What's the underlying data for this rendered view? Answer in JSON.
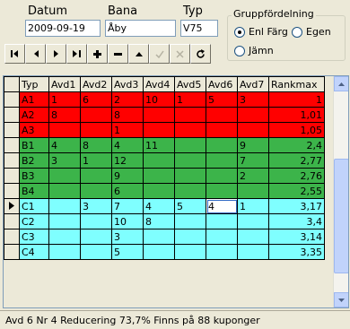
{
  "form": {
    "datum_label": "Datum",
    "datum_value": "2009-09-19",
    "bana_label": "Bana",
    "bana_value": "Åby",
    "typ_label": "Typ",
    "typ_value": "V75"
  },
  "group": {
    "title": "Gruppfördelning",
    "options": [
      {
        "label": "Enl Färg",
        "selected": true
      },
      {
        "label": "Egen",
        "selected": false
      },
      {
        "label": "Jämn",
        "selected": false
      }
    ]
  },
  "navigator": {
    "buttons": [
      "first-icon",
      "prior-icon",
      "next-icon",
      "last-icon",
      "insert-icon",
      "delete-icon",
      "edit-icon",
      "post-icon",
      "cancel-icon",
      "refresh-icon"
    ]
  },
  "grid": {
    "columns": [
      "Typ",
      "Avd1",
      "Avd2",
      "Avd3",
      "Avd4",
      "Avd5",
      "Avd6",
      "Avd7",
      "Rankmax"
    ],
    "rows": [
      {
        "color": "red",
        "cells": [
          "A1",
          "1",
          "6",
          "2",
          "10",
          "1",
          "5",
          "3",
          "1"
        ]
      },
      {
        "color": "red",
        "cells": [
          "A2",
          "8",
          "",
          "8",
          "",
          "",
          "",
          "",
          "1,01"
        ]
      },
      {
        "color": "red",
        "cells": [
          "A3",
          "",
          "",
          "1",
          "",
          "",
          "",
          "",
          "1,05"
        ]
      },
      {
        "color": "green",
        "cells": [
          "B1",
          "4",
          "8",
          "4",
          "11",
          "",
          "",
          "9",
          "2,4"
        ]
      },
      {
        "color": "green",
        "cells": [
          "B2",
          "3",
          "1",
          "12",
          "",
          "",
          "",
          "7",
          "2,77"
        ]
      },
      {
        "color": "green",
        "cells": [
          "B3",
          "",
          "",
          "9",
          "",
          "",
          "",
          "2",
          "2,76"
        ]
      },
      {
        "color": "green",
        "cells": [
          "B4",
          "",
          "",
          "6",
          "",
          "",
          "",
          "",
          "2,55"
        ]
      },
      {
        "color": "cyan",
        "current": true,
        "cells": [
          "C1",
          "",
          "3",
          "7",
          "4",
          "5",
          "4",
          "1",
          "3,17"
        ]
      },
      {
        "color": "cyan",
        "cells": [
          "C2",
          "",
          "",
          "10",
          "8",
          "",
          "",
          "",
          "3,4"
        ]
      },
      {
        "color": "cyan",
        "cells": [
          "C3",
          "",
          "",
          "3",
          "",
          "",
          "",
          "",
          "3,14"
        ]
      },
      {
        "color": "cyan",
        "cells": [
          "C4",
          "",
          "",
          "5",
          "",
          "",
          "",
          "",
          "3,35"
        ]
      }
    ]
  },
  "status": {
    "text": "Avd 6 Nr 4  Reducering 73,7% Finns på 88 kuponger"
  },
  "colors": {
    "red": "#ff0000",
    "green": "#3cb44a",
    "cyan": "#7fffff"
  }
}
